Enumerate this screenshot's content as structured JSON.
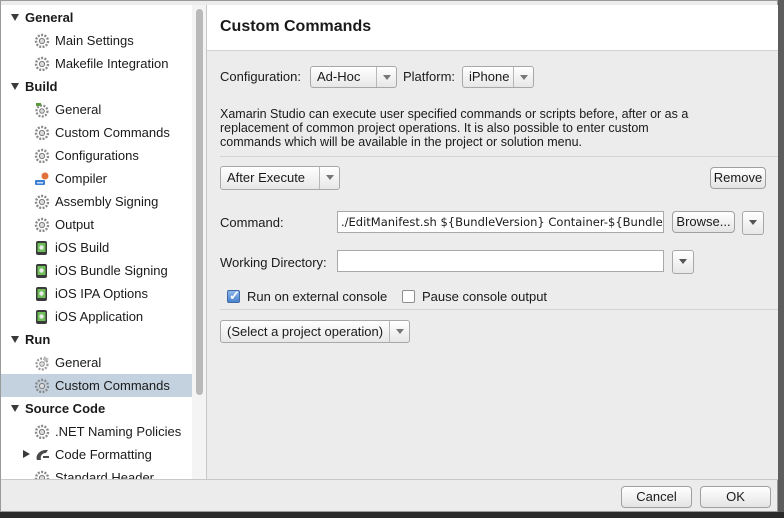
{
  "sidebar": {
    "categories": [
      {
        "label": "General",
        "items": [
          {
            "label": "Main Settings",
            "icon": "gear-icon"
          },
          {
            "label": "Makefile Integration",
            "icon": "gear-icon"
          }
        ]
      },
      {
        "label": "Build",
        "items": [
          {
            "label": "General",
            "icon": "build-gear-icon"
          },
          {
            "label": "Custom Commands",
            "icon": "gear-icon"
          },
          {
            "label": "Configurations",
            "icon": "gear-icon"
          },
          {
            "label": "Compiler",
            "icon": "compiler-icon"
          },
          {
            "label": "Assembly Signing",
            "icon": "gear-icon"
          },
          {
            "label": "Output",
            "icon": "gear-icon"
          },
          {
            "label": "iOS Build",
            "icon": "ios-device-icon"
          },
          {
            "label": "iOS Bundle Signing",
            "icon": "ios-device-icon"
          },
          {
            "label": "iOS IPA Options",
            "icon": "ios-device-icon"
          },
          {
            "label": "iOS Application",
            "icon": "ios-device-icon"
          }
        ]
      },
      {
        "label": "Run",
        "items": [
          {
            "label": "General",
            "icon": "run-gear-icon"
          },
          {
            "label": "Custom Commands",
            "icon": "gear-icon",
            "selected": true
          }
        ]
      },
      {
        "label": "Source Code",
        "items": [
          {
            "label": ".NET Naming Policies",
            "icon": "gear-icon"
          },
          {
            "label": "Code Formatting",
            "icon": "code-format-icon",
            "collapsed": true
          },
          {
            "label": "Standard Header",
            "icon": "gear-icon"
          }
        ]
      }
    ]
  },
  "panel": {
    "title": "Custom Commands",
    "configuration_label": "Configuration:",
    "configuration_value": "Ad-Hoc",
    "platform_label": "Platform:",
    "platform_value": "iPhone",
    "description": "Xamarin Studio can execute user specified commands or scripts before, after or as a replacement of common project operations. It is also possible to enter custom commands which will be available in the project or solution menu.",
    "event_value": "After Execute",
    "remove_label": "Remove",
    "command_label": "Command:",
    "command_value": "./EditManifest.sh ${BundleVersion} Container-${BundleI",
    "browse_label": "Browse...",
    "working_dir_label": "Working Directory:",
    "working_dir_value": "",
    "run_external_label": "Run on external console",
    "run_external_checked": true,
    "pause_label": "Pause console output",
    "pause_checked": false,
    "add_operation_value": "(Select a project operation)"
  },
  "footer": {
    "cancel_label": "Cancel",
    "ok_label": "OK"
  },
  "colors": {
    "selection": "#c4d2df",
    "dialog_bg": "#ececec",
    "checkbox_on": "#4a83cf"
  }
}
